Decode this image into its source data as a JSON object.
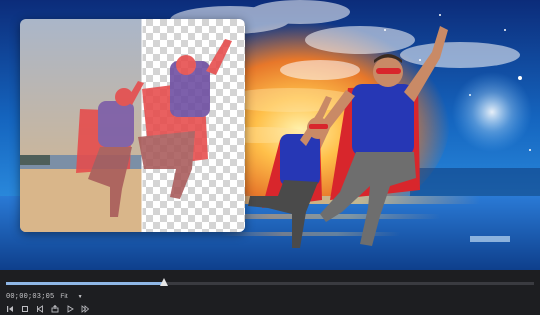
{
  "player": {
    "timecode": "00;00;03;05",
    "fit_label": "Fit",
    "progress": 0.3,
    "controls": [
      "set-in-icon",
      "stop-icon",
      "step-back-icon",
      "export-frame-icon",
      "play-icon",
      "step-forward-icon"
    ]
  },
  "colors": {
    "accent": "#8fb7e6",
    "player_bg": "#1d1e21",
    "cape": "#d8262c",
    "shirt": "#2637b5"
  }
}
